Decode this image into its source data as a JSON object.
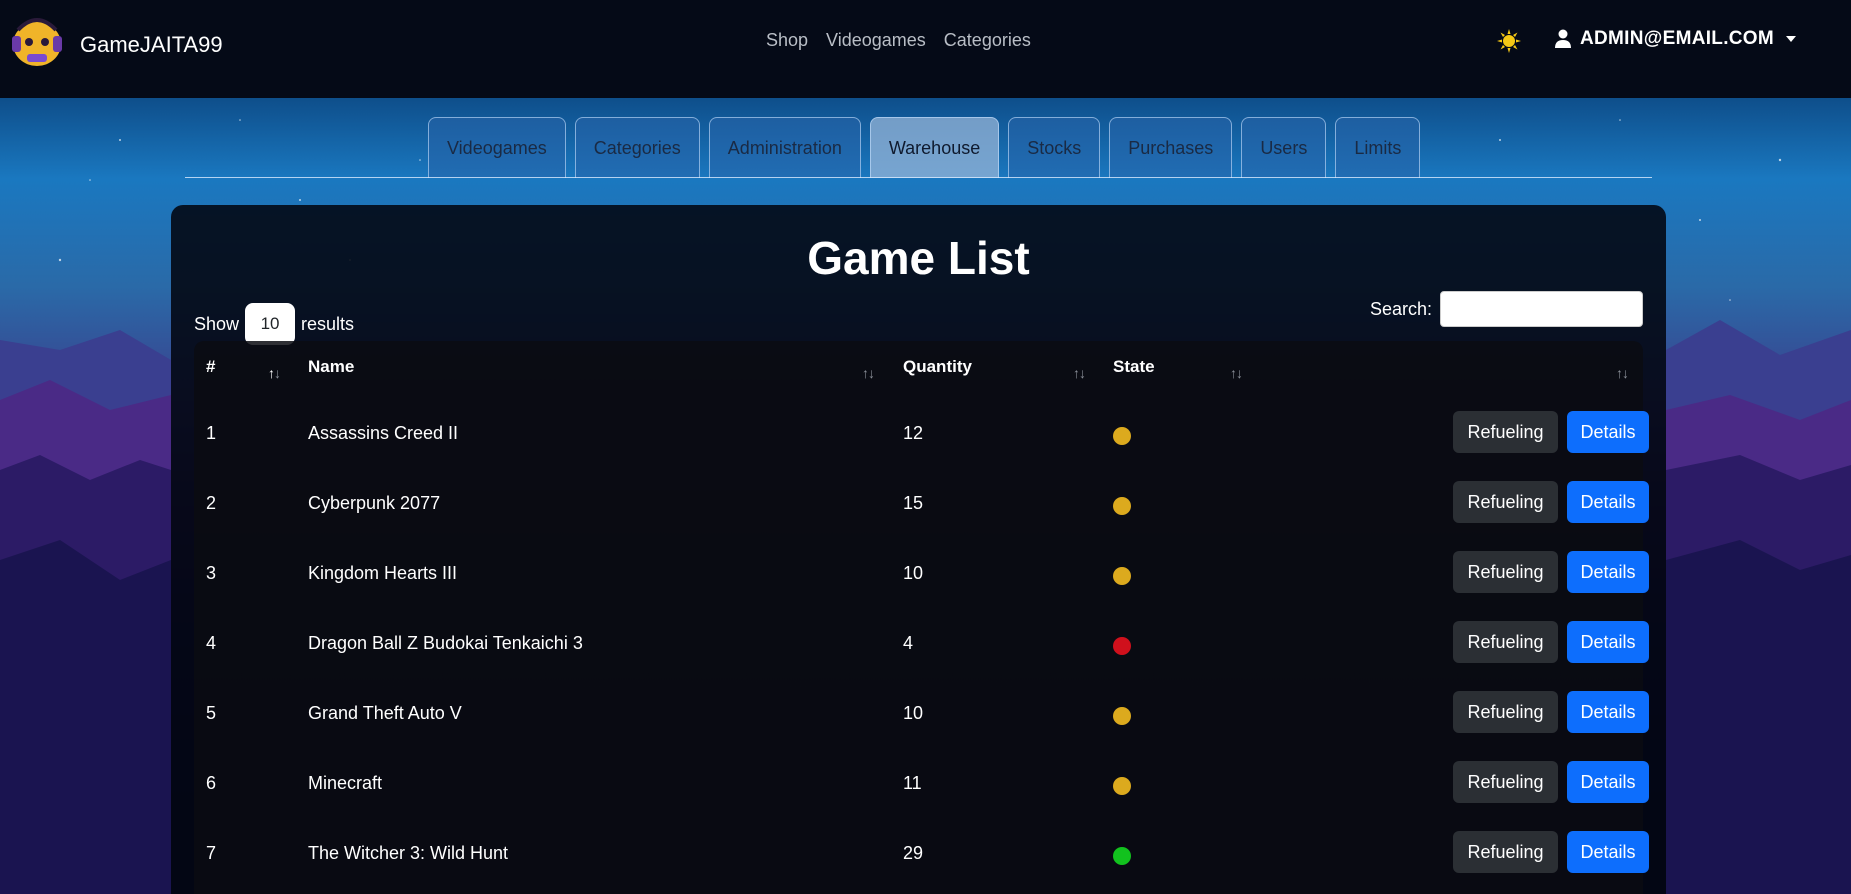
{
  "navbar": {
    "brand_name": "GameJAITA99",
    "links": [
      "Shop",
      "Videogames",
      "Categories"
    ],
    "user_email": "ADMIN@EMAIL.COM",
    "theme_icon": "sun-icon",
    "user_icon": "user-icon"
  },
  "tabs": [
    {
      "label": "Videogames",
      "active": false
    },
    {
      "label": "Categories",
      "active": false
    },
    {
      "label": "Administration",
      "active": false
    },
    {
      "label": "Warehouse",
      "active": true
    },
    {
      "label": "Stocks",
      "active": false
    },
    {
      "label": "Purchases",
      "active": false
    },
    {
      "label": "Users",
      "active": false
    },
    {
      "label": "Limits",
      "active": false
    }
  ],
  "main": {
    "title": "Game List",
    "show_prefix": "Show",
    "show_value": "10",
    "show_suffix": "results",
    "search_label": "Search:",
    "search_value": ""
  },
  "table": {
    "columns": [
      "#",
      "Name",
      "Quantity",
      "State"
    ],
    "refuel_label": "Refueling",
    "details_label": "Details",
    "state_colors": {
      "yellow": "#dcaa1e",
      "red": "#d0101c",
      "green": "#12c21e"
    },
    "rows": [
      {
        "num": "1",
        "name": "Assassins Creed II",
        "qty": "12",
        "state": "yellow"
      },
      {
        "num": "2",
        "name": "Cyberpunk 2077",
        "qty": "15",
        "state": "yellow"
      },
      {
        "num": "3",
        "name": "Kingdom Hearts III",
        "qty": "10",
        "state": "yellow"
      },
      {
        "num": "4",
        "name": "Dragon Ball Z Budokai Tenkaichi 3",
        "qty": "4",
        "state": "red"
      },
      {
        "num": "5",
        "name": "Grand Theft Auto V",
        "qty": "10",
        "state": "yellow"
      },
      {
        "num": "6",
        "name": "Minecraft",
        "qty": "11",
        "state": "yellow"
      },
      {
        "num": "7",
        "name": "The Witcher 3: Wild Hunt",
        "qty": "29",
        "state": "green"
      }
    ]
  }
}
